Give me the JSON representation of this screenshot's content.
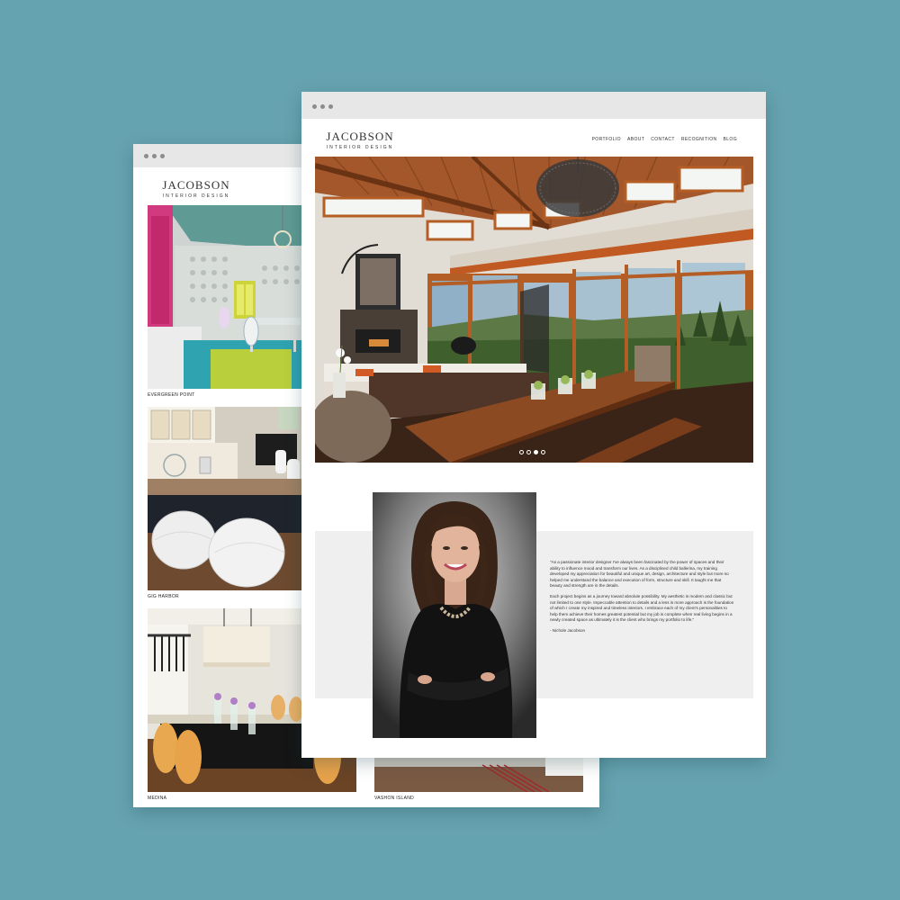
{
  "brand": {
    "name": "JACOBSON",
    "tagline": "INTERIOR DESIGN"
  },
  "nav": [
    "PORTFOLIO",
    "ABOUT",
    "CONTACT",
    "RECOGNITION",
    "BLOG"
  ],
  "portfolio": {
    "items": [
      {
        "label": "EVERGREEN POINT"
      },
      {
        "label": "GIG HARBOR"
      },
      {
        "label": "MEDINA"
      },
      {
        "label": "VASHON ISLAND"
      }
    ]
  },
  "hero": {
    "slide_count": 4,
    "active_slide": 3
  },
  "about": {
    "quote": "\"As a passionate interior designer I've always been fascinated by the power of spaces and their ability to influence mood and transform our lives. As a disciplined child ballerina, my training developed my appreciation for beautiful and unique art, design, architecture and style but more so helped me understand the balance and execution of form, structure and skill. It taught me that beauty and strength are in the details.",
    "paragraph2": "Each project begins as a journey toward absolute possibility. My aesthetic is modern and classic but not limited to one style. Impeccable attention to details and a less is more approach is the foundation of which I create my inspired and timeless interiors. I embrace each of my client's personalities to help them achieve their homes greatest potential but my job is complete when real living begins in a newly created space as ultimately it is the client who brings my portfolio to life.\"",
    "signature": "- Nichole Jacobson"
  },
  "colors": {
    "background": "#66a3b0",
    "window_bar": "#e7e7e7",
    "wood": "#9a4f22",
    "about_panel": "#efefef"
  }
}
